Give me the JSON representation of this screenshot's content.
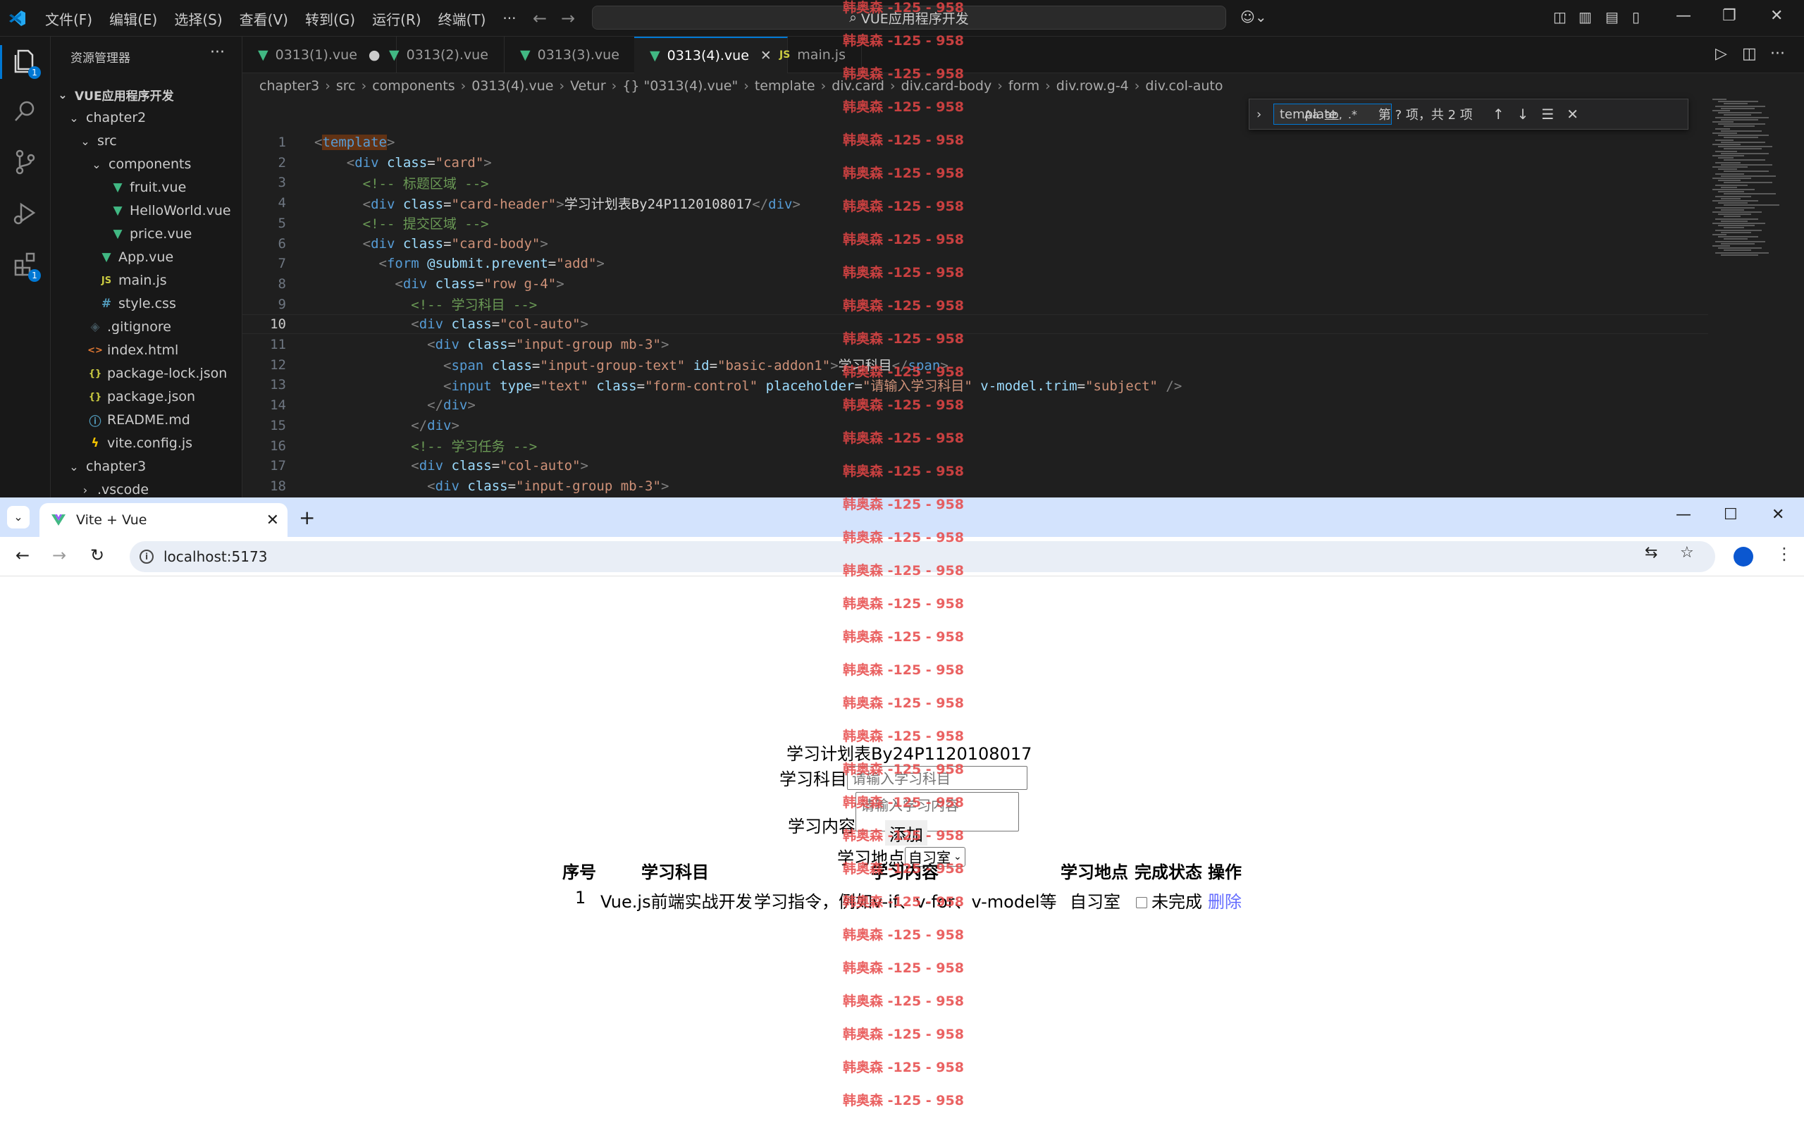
{
  "vscode": {
    "menu": [
      "文件(F)",
      "编辑(E)",
      "选择(S)",
      "查看(V)",
      "转到(G)",
      "运行(R)",
      "终端(T)",
      "···"
    ],
    "search_text": "VUE应用程序开发",
    "explorer_title": "资源管理器",
    "activity_badges": [
      "1",
      "1"
    ],
    "tree": [
      {
        "label": "VUE应用程序开发",
        "indent": 0,
        "twisty": "v",
        "icon": "",
        "bold": true
      },
      {
        "label": "chapter2",
        "indent": 1,
        "twisty": "v",
        "icon": ""
      },
      {
        "label": "src",
        "indent": 2,
        "twisty": "v",
        "icon": ""
      },
      {
        "label": "components",
        "indent": 3,
        "twisty": "v",
        "icon": ""
      },
      {
        "label": "fruit.vue",
        "indent": 4,
        "twisty": "",
        "icon": "vue"
      },
      {
        "label": "HelloWorld.vue",
        "indent": 4,
        "twisty": "",
        "icon": "vue"
      },
      {
        "label": "price.vue",
        "indent": 4,
        "twisty": "",
        "icon": "vue"
      },
      {
        "label": "App.vue",
        "indent": 3,
        "twisty": "",
        "icon": "vue"
      },
      {
        "label": "main.js",
        "indent": 3,
        "twisty": "",
        "icon": "js"
      },
      {
        "label": "style.css",
        "indent": 3,
        "twisty": "",
        "icon": "css"
      },
      {
        "label": ".gitignore",
        "indent": 2,
        "twisty": "",
        "icon": "git"
      },
      {
        "label": "index.html",
        "indent": 2,
        "twisty": "",
        "icon": "html"
      },
      {
        "label": "package-lock.json",
        "indent": 2,
        "twisty": "",
        "icon": "json"
      },
      {
        "label": "package.json",
        "indent": 2,
        "twisty": "",
        "icon": "json"
      },
      {
        "label": "README.md",
        "indent": 2,
        "twisty": "",
        "icon": "info"
      },
      {
        "label": "vite.config.js",
        "indent": 2,
        "twisty": "",
        "icon": "vite"
      },
      {
        "label": "chapter3",
        "indent": 1,
        "twisty": "v",
        "icon": ""
      },
      {
        "label": ".vscode",
        "indent": 2,
        "twisty": ">",
        "icon": ""
      }
    ],
    "tabs": [
      {
        "label": "0313(1).vue",
        "kind": "vue",
        "state": "dirty"
      },
      {
        "label": "0313(2).vue",
        "kind": "vue",
        "state": ""
      },
      {
        "label": "0313(3).vue",
        "kind": "vue",
        "state": ""
      },
      {
        "label": "0313(4).vue",
        "kind": "vue",
        "state": "active"
      },
      {
        "label": "main.js",
        "kind": "js",
        "state": ""
      }
    ],
    "breadcrumb": [
      "chapter3",
      "src",
      "components",
      "0313(4).vue",
      "Vetur",
      "{} \"0313(4).vue\"",
      "template",
      "div.card",
      "div.card-body",
      "form",
      "div.row.g-4",
      "div.col-auto"
    ],
    "find": {
      "query": "template",
      "count": "第 ? 项，共 2 项"
    },
    "current_line": 10,
    "code_lines": [
      [
        [
          "c-br",
          "<"
        ],
        [
          "hl",
          "template"
        ],
        [
          "c-br",
          ">"
        ]
      ],
      [
        [
          "",
          "    "
        ],
        [
          "c-br",
          "<"
        ],
        [
          "c-tag",
          "div "
        ],
        [
          "c-attr",
          "class"
        ],
        [
          "c-txt",
          "="
        ],
        [
          "c-str",
          "\"card\""
        ],
        [
          "c-br",
          ">"
        ]
      ],
      [
        [
          "",
          "      "
        ],
        [
          "c-com",
          "<!-- 标题区域 -->"
        ]
      ],
      [
        [
          "",
          "      "
        ],
        [
          "c-br",
          "<"
        ],
        [
          "c-tag",
          "div "
        ],
        [
          "c-attr",
          "class"
        ],
        [
          "c-txt",
          "="
        ],
        [
          "c-str",
          "\"card-header\""
        ],
        [
          "c-br",
          ">"
        ],
        [
          "c-txt",
          "学习计划表By24P1120108017"
        ],
        [
          "c-br",
          "</"
        ],
        [
          "c-tag",
          "div"
        ],
        [
          "c-br",
          ">"
        ]
      ],
      [
        [
          "",
          "      "
        ],
        [
          "c-com",
          "<!-- 提交区域 -->"
        ]
      ],
      [
        [
          "",
          "      "
        ],
        [
          "c-br",
          "<"
        ],
        [
          "c-tag",
          "div "
        ],
        [
          "c-attr",
          "class"
        ],
        [
          "c-txt",
          "="
        ],
        [
          "c-str",
          "\"card-body\""
        ],
        [
          "c-br",
          ">"
        ]
      ],
      [
        [
          "",
          "        "
        ],
        [
          "c-br",
          "<"
        ],
        [
          "c-tag",
          "form "
        ],
        [
          "c-attr",
          "@submit.prevent"
        ],
        [
          "c-txt",
          "="
        ],
        [
          "c-str",
          "\"add\""
        ],
        [
          "c-br",
          ">"
        ]
      ],
      [
        [
          "",
          "          "
        ],
        [
          "c-br",
          "<"
        ],
        [
          "c-tag",
          "div "
        ],
        [
          "c-attr",
          "class"
        ],
        [
          "c-txt",
          "="
        ],
        [
          "c-str",
          "\"row g-4\""
        ],
        [
          "c-br",
          ">"
        ]
      ],
      [
        [
          "",
          "            "
        ],
        [
          "c-com",
          "<!-- 学习科目 -->"
        ]
      ],
      [
        [
          "",
          "            "
        ],
        [
          "c-br",
          "<"
        ],
        [
          "c-tag",
          "div "
        ],
        [
          "c-attr",
          "class"
        ],
        [
          "c-txt",
          "="
        ],
        [
          "c-str",
          "\"col-auto\""
        ],
        [
          "c-br",
          ">"
        ]
      ],
      [
        [
          "",
          "              "
        ],
        [
          "c-br",
          "<"
        ],
        [
          "c-tag",
          "div "
        ],
        [
          "c-attr",
          "class"
        ],
        [
          "c-txt",
          "="
        ],
        [
          "c-str",
          "\"input-group mb-3\""
        ],
        [
          "c-br",
          ">"
        ]
      ],
      [
        [
          "",
          "                "
        ],
        [
          "c-br",
          "<"
        ],
        [
          "c-tag",
          "span "
        ],
        [
          "c-attr",
          "class"
        ],
        [
          "c-txt",
          "="
        ],
        [
          "c-str",
          "\"input-group-text\" "
        ],
        [
          "c-attr",
          "id"
        ],
        [
          "c-txt",
          "="
        ],
        [
          "c-str",
          "\"basic-addon1\""
        ],
        [
          "c-br",
          ">"
        ],
        [
          "c-txt",
          "学习科目"
        ],
        [
          "c-br",
          "</"
        ],
        [
          "c-tag",
          "span"
        ],
        [
          "c-br",
          ">"
        ]
      ],
      [
        [
          "",
          "                "
        ],
        [
          "c-br",
          "<"
        ],
        [
          "c-tag",
          "input "
        ],
        [
          "c-attr",
          "type"
        ],
        [
          "c-txt",
          "="
        ],
        [
          "c-str",
          "\"text\" "
        ],
        [
          "c-attr",
          "class"
        ],
        [
          "c-txt",
          "="
        ],
        [
          "c-str",
          "\"form-control\" "
        ],
        [
          "c-attr",
          "placeholder"
        ],
        [
          "c-txt",
          "="
        ],
        [
          "c-str",
          "\"请输入学习科目\" "
        ],
        [
          "c-attr",
          "v-model.trim"
        ],
        [
          "c-txt",
          "="
        ],
        [
          "c-str",
          "\"subject\" "
        ],
        [
          "c-br",
          "/>"
        ]
      ],
      [
        [
          "",
          "              "
        ],
        [
          "c-br",
          "</"
        ],
        [
          "c-tag",
          "div"
        ],
        [
          "c-br",
          ">"
        ]
      ],
      [
        [
          "",
          "            "
        ],
        [
          "c-br",
          "</"
        ],
        [
          "c-tag",
          "div"
        ],
        [
          "c-br",
          ">"
        ]
      ],
      [
        [
          "",
          "            "
        ],
        [
          "c-com",
          "<!-- 学习任务 -->"
        ]
      ],
      [
        [
          "",
          "            "
        ],
        [
          "c-br",
          "<"
        ],
        [
          "c-tag",
          "div "
        ],
        [
          "c-attr",
          "class"
        ],
        [
          "c-txt",
          "="
        ],
        [
          "c-str",
          "\"col-auto\""
        ],
        [
          "c-br",
          ">"
        ]
      ],
      [
        [
          "",
          "              "
        ],
        [
          "c-br",
          "<"
        ],
        [
          "c-tag",
          "div "
        ],
        [
          "c-attr",
          "class"
        ],
        [
          "c-txt",
          "="
        ],
        [
          "c-str",
          "\"input-group mb-3\""
        ],
        [
          "c-br",
          ">"
        ]
      ]
    ]
  },
  "watermark": "韩奥森 -125 - 958",
  "chrome": {
    "tab_title": "Vite + Vue",
    "url": "localhost:5173"
  },
  "app": {
    "title": "学习计划表By24P1120108017",
    "subject_label": "学习科目",
    "subject_placeholder": "请输入学习科目",
    "content_label": "学习内容",
    "content_placeholder": "请输入学习内容",
    "location_label": "学习地点",
    "location_selected": "自习室",
    "add_label": "添加",
    "table_headers": [
      "序号",
      "学习科目",
      "学习内容",
      "学习地点",
      "完成状态",
      "操作"
    ],
    "rows": [
      {
        "index": "1",
        "subject": "Vue.js前端实战开发",
        "content": "学习指令，例如v-if、v-for、v-model等",
        "location": "自习室",
        "status": "未完成",
        "action": "删除"
      }
    ]
  }
}
